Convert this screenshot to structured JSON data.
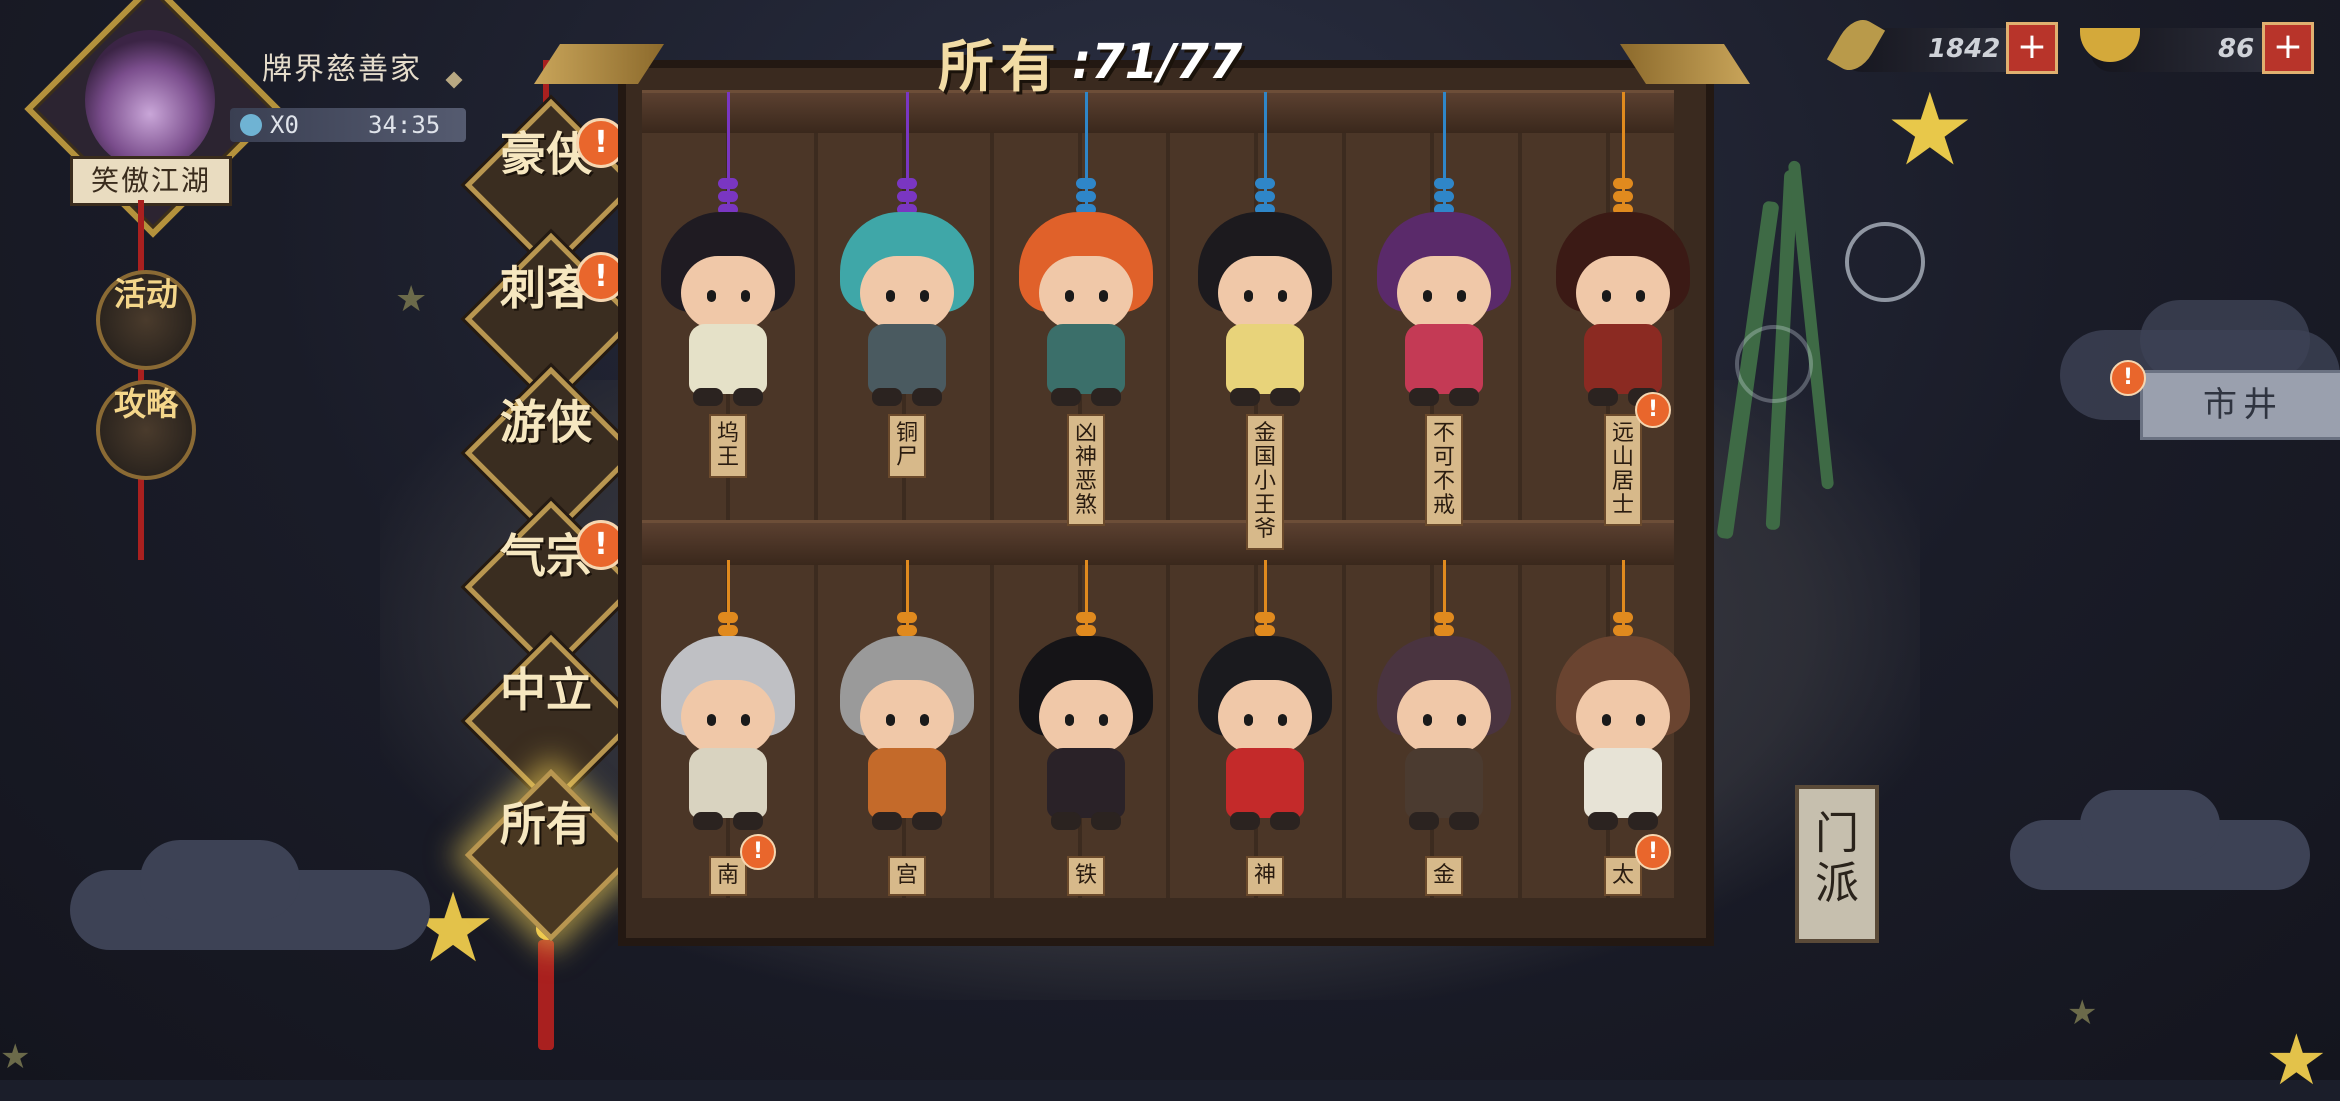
{
  "player": {
    "name": "牌界慈善家",
    "title": "笑傲江湖",
    "energy_count": "X0",
    "energy_timer": "34:35"
  },
  "side_buttons": {
    "events": "活动",
    "guide": "攻略"
  },
  "categories": [
    {
      "label": "豪侠",
      "alert": "!",
      "active": false
    },
    {
      "label": "刺客",
      "alert": "!",
      "active": false
    },
    {
      "label": "游侠",
      "alert": "",
      "active": false
    },
    {
      "label": "气宗",
      "alert": "!",
      "active": false
    },
    {
      "label": "中立",
      "alert": "",
      "active": false
    },
    {
      "label": "所有",
      "alert": "",
      "active": true
    }
  ],
  "collection": {
    "label": "所有",
    "count": ":71/77"
  },
  "characters_row1": [
    {
      "name": "坞王",
      "bead_color": "#7a36c2",
      "hair": "#1f1b22",
      "outfit": "#e5e1c8",
      "alert": ""
    },
    {
      "name": "铜尸",
      "bead_color": "#7a36c2",
      "hair": "#3fa7a8",
      "outfit": "#4a5a60",
      "alert": ""
    },
    {
      "name": "凶神恶煞",
      "bead_color": "#2f86c8",
      "hair": "#e0612a",
      "outfit": "#3b6f6a",
      "alert": ""
    },
    {
      "name": "金国小王爷",
      "bead_color": "#2f86c8",
      "hair": "#1c1a1e",
      "outfit": "#e8d37a",
      "alert": ""
    },
    {
      "name": "不可不戒",
      "bead_color": "#2f86c8",
      "hair": "#5a2a6a",
      "outfit": "#c43a55",
      "alert": ""
    },
    {
      "name": "远山居士",
      "bead_color": "#e08a1e",
      "hair": "#3b1a15",
      "outfit": "#8b2a22",
      "alert": "!"
    }
  ],
  "characters_row2": [
    {
      "name": "南",
      "bead_color": "#e08a1e",
      "hair": "#bfc0c4",
      "outfit": "#d9d3c0",
      "alert": "!"
    },
    {
      "name": "宫",
      "bead_color": "#e08a1e",
      "hair": "#9a9a9a",
      "outfit": "#c46a2a",
      "alert": ""
    },
    {
      "name": "铁",
      "bead_color": "#e08a1e",
      "hair": "#151417",
      "outfit": "#2a2228",
      "alert": ""
    },
    {
      "name": "神",
      "bead_color": "#e08a1e",
      "hair": "#1a1a1e",
      "outfit": "#c42a2a",
      "alert": ""
    },
    {
      "name": "金",
      "bead_color": "#e08a1e",
      "hair": "#4a3440",
      "outfit": "#4b3b30",
      "alert": ""
    },
    {
      "name": "太",
      "bead_color": "#e08a1e",
      "hair": "#6a4430",
      "outfit": "#e7e3d6",
      "alert": "!"
    }
  ],
  "currencies": {
    "leaf": "1842",
    "ingot": "86",
    "plus": "+"
  },
  "map_labels": {
    "market": "市井",
    "sect": "门派"
  }
}
